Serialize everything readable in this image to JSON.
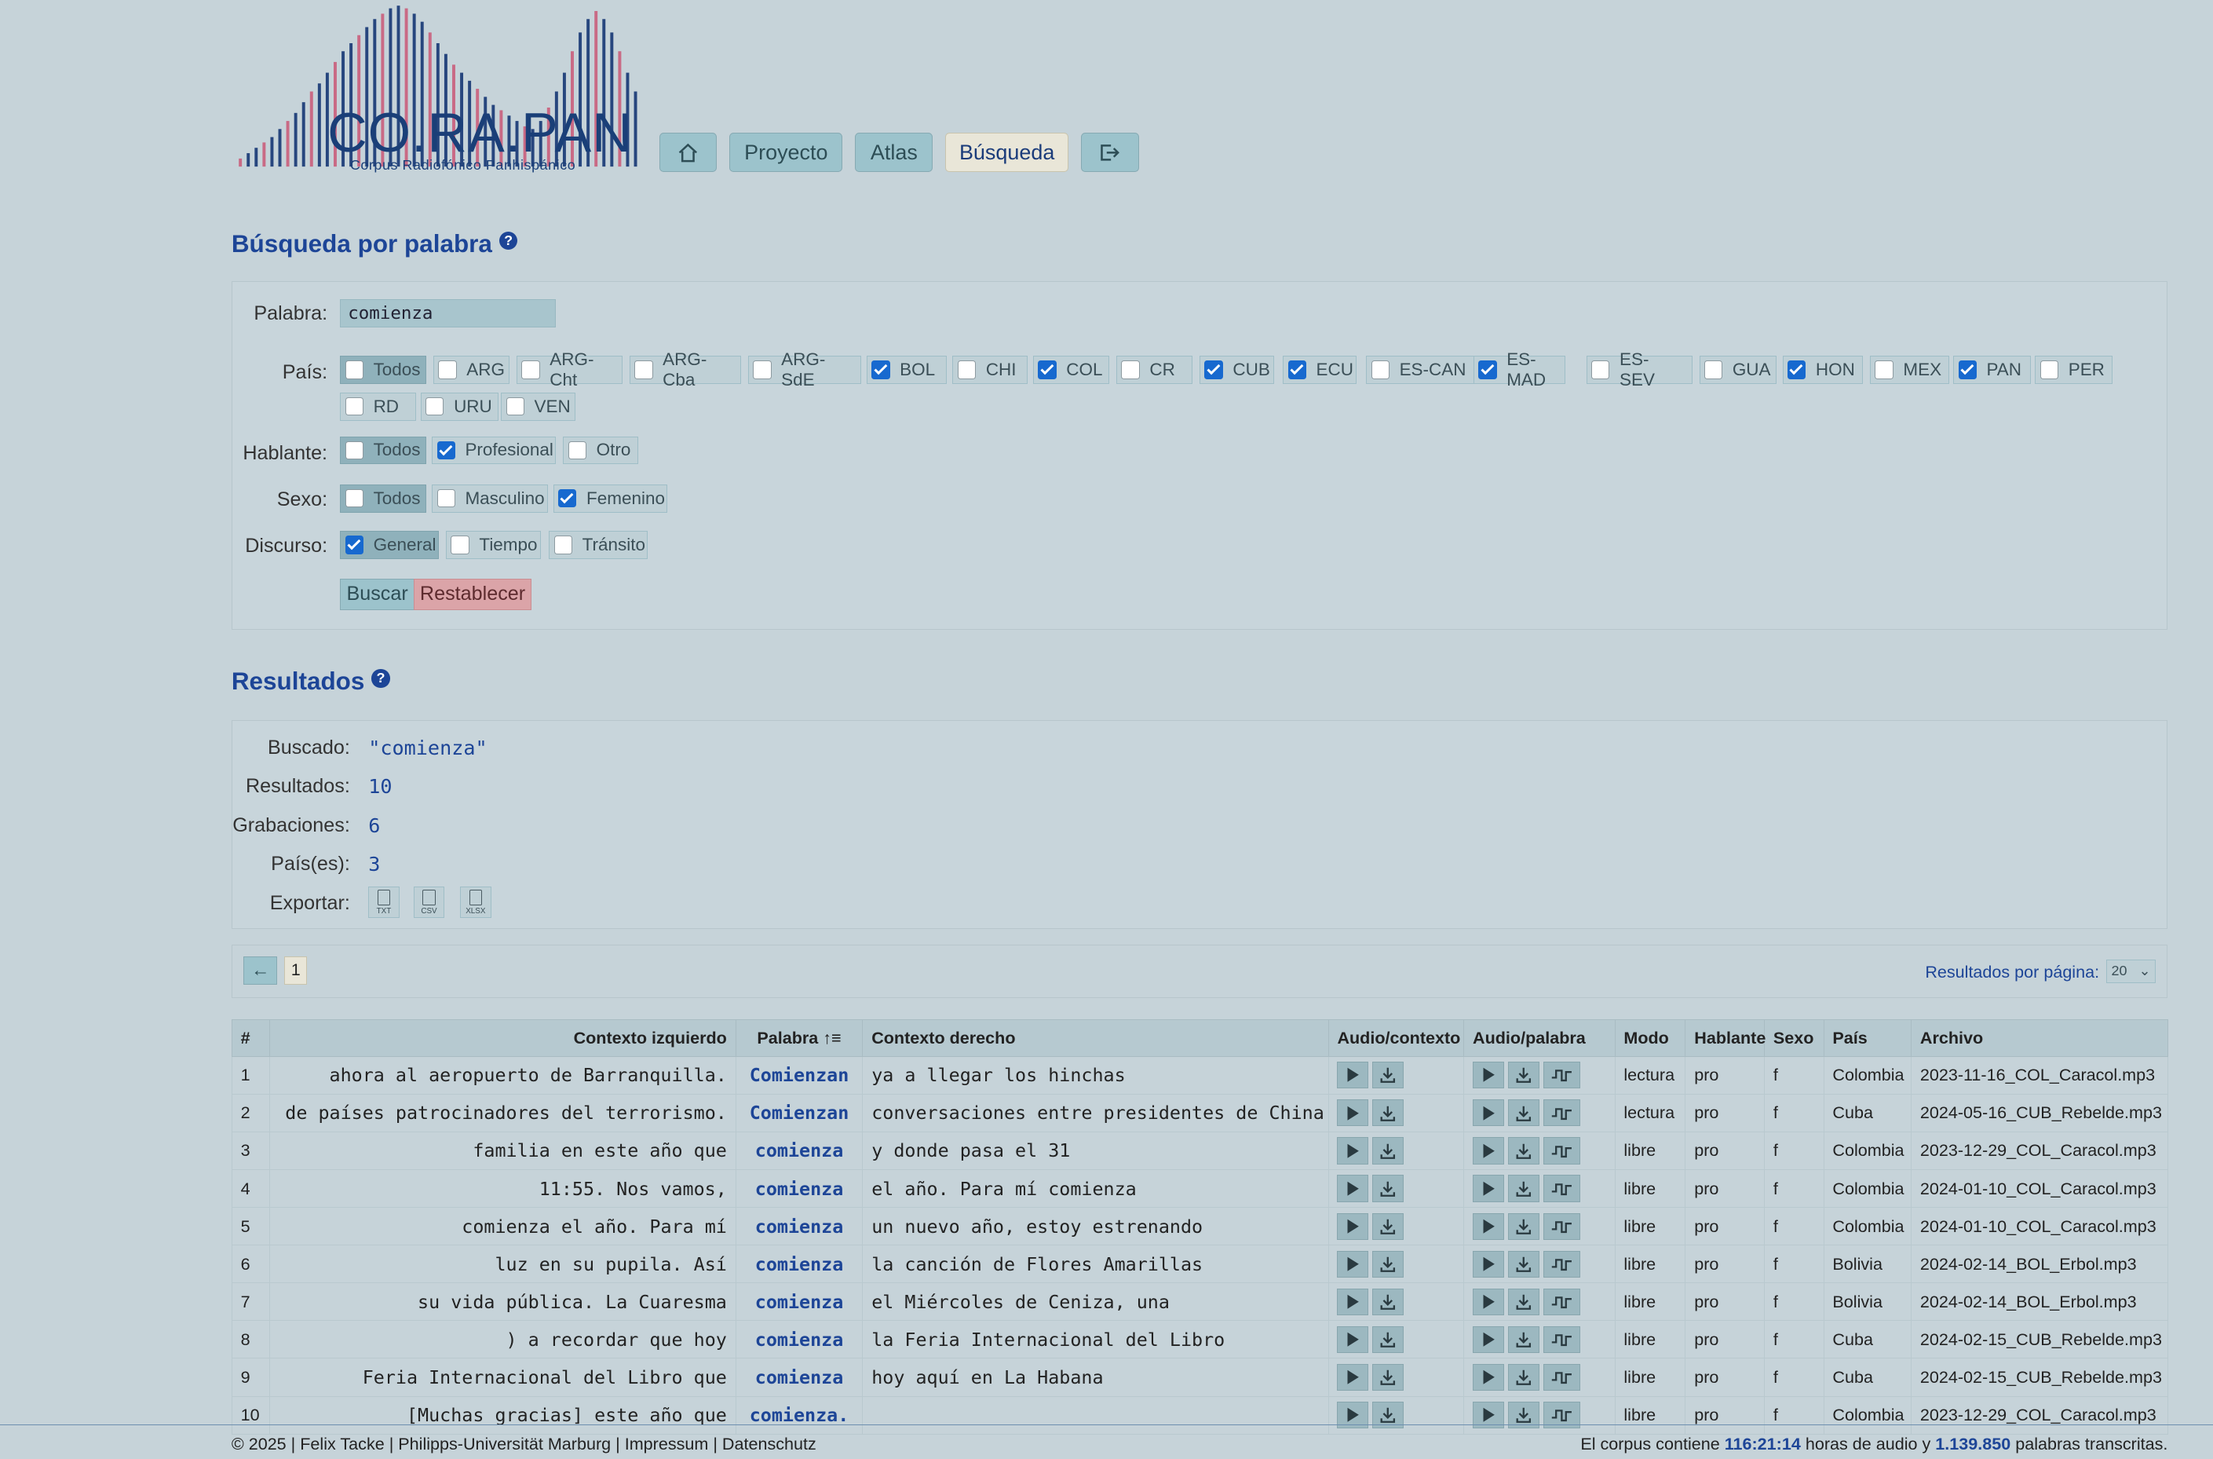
{
  "brand": {
    "name": "CO.RA.PAN",
    "subtitle": "Corpus Radiofónico Panhispánico"
  },
  "nav": {
    "items": [
      {
        "name": "home",
        "label": "",
        "icon": "home-icon"
      },
      {
        "name": "proyecto",
        "label": "Proyecto"
      },
      {
        "name": "atlas",
        "label": "Atlas"
      },
      {
        "name": "busqueda",
        "label": "Búsqueda",
        "active": true
      },
      {
        "name": "logout",
        "label": "",
        "icon": "logout-icon"
      }
    ]
  },
  "search": {
    "title": "Búsqueda por palabra",
    "help": "?",
    "word_label": "Palabra:",
    "word_value": "comienza",
    "country_label": "País:",
    "countries": [
      {
        "label": "Todos",
        "checked": false
      },
      {
        "label": "ARG",
        "checked": false
      },
      {
        "label": "ARG-Cht",
        "checked": false
      },
      {
        "label": "ARG-Cba",
        "checked": false
      },
      {
        "label": "ARG-SdE",
        "checked": false
      },
      {
        "label": "BOL",
        "checked": true
      },
      {
        "label": "CHI",
        "checked": false
      },
      {
        "label": "COL",
        "checked": true
      },
      {
        "label": "CR",
        "checked": false
      },
      {
        "label": "CUB",
        "checked": true
      },
      {
        "label": "ECU",
        "checked": true
      },
      {
        "label": "ES-CAN",
        "checked": false
      },
      {
        "label": "ES-MAD",
        "checked": true
      },
      {
        "label": "ES-SEV",
        "checked": false
      },
      {
        "label": "GUA",
        "checked": false
      },
      {
        "label": "HON",
        "checked": true
      },
      {
        "label": "MEX",
        "checked": false
      },
      {
        "label": "PAN",
        "checked": true
      },
      {
        "label": "PER",
        "checked": false
      },
      {
        "label": "RD",
        "checked": false
      },
      {
        "label": "URU",
        "checked": false
      },
      {
        "label": "VEN",
        "checked": false
      }
    ],
    "speaker_label": "Hablante:",
    "speakers": [
      {
        "label": "Todos",
        "checked": false
      },
      {
        "label": "Profesional",
        "checked": true
      },
      {
        "label": "Otro",
        "checked": false
      }
    ],
    "sex_label": "Sexo:",
    "sexes": [
      {
        "label": "Todos",
        "checked": false
      },
      {
        "label": "Masculino",
        "checked": false
      },
      {
        "label": "Femenino",
        "checked": true
      }
    ],
    "discourse_label": "Discurso:",
    "discourses": [
      {
        "label": "General",
        "checked": true
      },
      {
        "label": "Tiempo",
        "checked": false
      },
      {
        "label": "Tránsito",
        "checked": false
      }
    ],
    "search_button": "Buscar",
    "reset_button": "Restablecer"
  },
  "results": {
    "title": "Resultados",
    "help": "?",
    "searched_label": "Buscado:",
    "searched_value": "\"comienza\"",
    "count_label": "Resultados:",
    "count_value": "10",
    "recordings_label": "Grabaciones:",
    "recordings_value": "6",
    "countries_label": "País(es):",
    "countries_value": "3",
    "export_label": "Exportar:",
    "export_formats": [
      "TXT",
      "CSV",
      "XLSX"
    ]
  },
  "pager": {
    "prev": "←",
    "page": "1",
    "per_page_label": "Resultados por página:",
    "per_page_value": "20"
  },
  "table": {
    "headers": {
      "num": "#",
      "left": "Contexto izquierdo",
      "word": "Palabra ↑≡",
      "right": "Contexto derecho",
      "audio_ctx": "Audio/contexto",
      "audio_word": "Audio/palabra",
      "mode": "Modo",
      "speaker": "Hablante",
      "sex": "Sexo",
      "country": "País",
      "file": "Archivo"
    },
    "rows": [
      {
        "n": "1",
        "left": "ahora al aeropuerto de Barranquilla.",
        "word": "Comienzan",
        "right": "ya a llegar los hinchas",
        "mode": "lectura",
        "speaker": "pro",
        "sex": "f",
        "country": "Colombia",
        "file": "2023-11-16_COL_Caracol.mp3"
      },
      {
        "n": "2",
        "left": "de países patrocinadores del terrorismo.",
        "word": "Comienzan",
        "right": "conversaciones entre presidentes de China",
        "mode": "lectura",
        "speaker": "pro",
        "sex": "f",
        "country": "Cuba",
        "file": "2024-05-16_CUB_Rebelde.mp3"
      },
      {
        "n": "3",
        "left": "familia en este año que",
        "word": "comienza",
        "right": "y donde pasa el 31",
        "mode": "libre",
        "speaker": "pro",
        "sex": "f",
        "country": "Colombia",
        "file": "2023-12-29_COL_Caracol.mp3"
      },
      {
        "n": "4",
        "left": "11:55. Nos vamos,",
        "word": "comienza",
        "right": "el año. Para mí comienza",
        "mode": "libre",
        "speaker": "pro",
        "sex": "f",
        "country": "Colombia",
        "file": "2024-01-10_COL_Caracol.mp3"
      },
      {
        "n": "5",
        "left": "comienza el año. Para mí",
        "word": "comienza",
        "right": "un nuevo año, estoy estrenando",
        "mode": "libre",
        "speaker": "pro",
        "sex": "f",
        "country": "Colombia",
        "file": "2024-01-10_COL_Caracol.mp3"
      },
      {
        "n": "6",
        "left": "luz en su pupila. Así",
        "word": "comienza",
        "right": "la canción de Flores Amarillas",
        "mode": "libre",
        "speaker": "pro",
        "sex": "f",
        "country": "Bolivia",
        "file": "2024-02-14_BOL_Erbol.mp3"
      },
      {
        "n": "7",
        "left": "su vida pública. La Cuaresma",
        "word": "comienza",
        "right": "el Miércoles de Ceniza, una",
        "mode": "libre",
        "speaker": "pro",
        "sex": "f",
        "country": "Bolivia",
        "file": "2024-02-14_BOL_Erbol.mp3"
      },
      {
        "n": "8",
        "left": ") a recordar que hoy",
        "word": "comienza",
        "right": "la Feria Internacional del Libro",
        "mode": "libre",
        "speaker": "pro",
        "sex": "f",
        "country": "Cuba",
        "file": "2024-02-15_CUB_Rebelde.mp3"
      },
      {
        "n": "9",
        "left": "Feria Internacional del Libro que",
        "word": "comienza",
        "right": "hoy aquí en La Habana",
        "mode": "libre",
        "speaker": "pro",
        "sex": "f",
        "country": "Cuba",
        "file": "2024-02-15_CUB_Rebelde.mp3"
      },
      {
        "n": "10",
        "left": "[Muchas gracias] este año que",
        "word": "comienza.",
        "right": "",
        "mode": "libre",
        "speaker": "pro",
        "sex": "f",
        "country": "Colombia",
        "file": "2023-12-29_COL_Caracol.mp3"
      }
    ]
  },
  "footer": {
    "left": "© 2025 | Felix Tacke | Philipps-Universität Marburg | Impressum | Datenschutz",
    "right_prefix": "El corpus contiene",
    "hours": "116:21:14",
    "right_mid": "horas de audio y",
    "words": "1.139.850",
    "right_suffix": "palabras transcritas."
  }
}
